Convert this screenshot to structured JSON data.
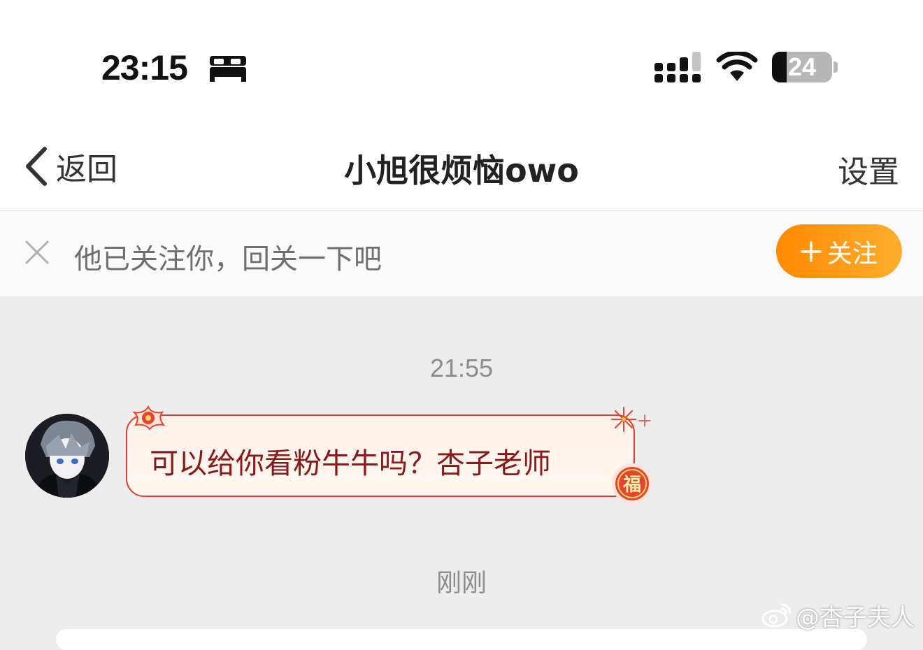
{
  "status_bar": {
    "time": "23:15",
    "battery_percent": "24",
    "battery_level": 0.24,
    "icons": [
      "bed-icon",
      "cellular-signal-icon",
      "wifi-icon",
      "battery-icon"
    ]
  },
  "nav": {
    "back_label": "返回",
    "title": "小旭很烦恼owo",
    "settings_label": "设置"
  },
  "follow_banner": {
    "text": "他已关注你，回关一下吧",
    "button_label": "关注",
    "button_color": "#ff8a00"
  },
  "messages": [
    {
      "timestamp": "21:55",
      "text": "可以给你看粉牛牛吗？杏子老师",
      "bubble_border_color": "#d6402c",
      "text_color": "#8a1a1a"
    }
  ],
  "latest_timestamp": "刚刚",
  "decorations": {
    "badge_char": "福"
  },
  "watermark": {
    "text": "@杏子夫人"
  }
}
